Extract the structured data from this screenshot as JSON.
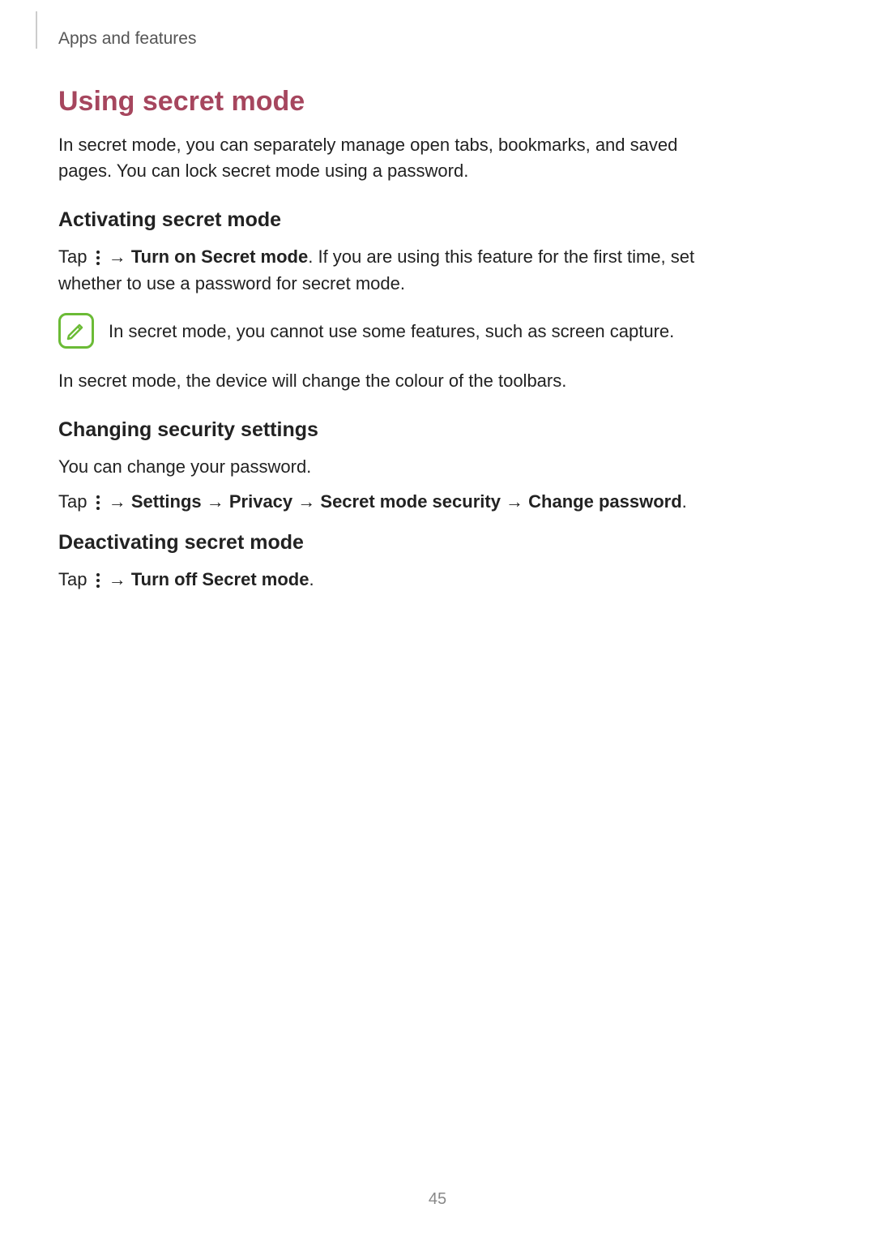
{
  "header": {
    "breadcrumb": "Apps and features"
  },
  "main": {
    "title": "Using secret mode",
    "intro": "In secret mode, you can separately manage open tabs, bookmarks, and saved pages. You can lock secret mode using a password.",
    "section1": {
      "heading": "Activating secret mode",
      "tap_prefix": "Tap ",
      "arrow": " → ",
      "bold1": "Turn on Secret mode",
      "rest": ". If you are using this feature for the first time, set whether to use a password for secret mode.",
      "note": "In secret mode, you cannot use some features, such as screen capture.",
      "after_note": "In secret mode, the device will change the colour of the toolbars."
    },
    "section2": {
      "heading": "Changing security settings",
      "line1": "You can change your password.",
      "tap_prefix": "Tap ",
      "arrow": " → ",
      "path_settings": "Settings",
      "path_privacy": "Privacy",
      "path_secret": "Secret mode security",
      "path_change": "Change password",
      "period": "."
    },
    "section3": {
      "heading": "Deactivating secret mode",
      "tap_prefix": "Tap ",
      "arrow": " → ",
      "bold1": "Turn off Secret mode",
      "period": "."
    }
  },
  "footer": {
    "page_number": "45"
  }
}
